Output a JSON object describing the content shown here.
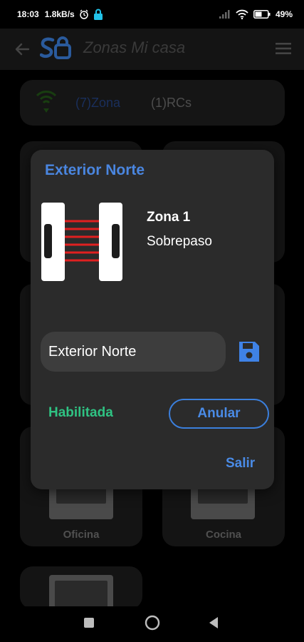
{
  "status_bar": {
    "time": "18:03",
    "speed": "1.8kB/s",
    "battery": "49%"
  },
  "app_bar": {
    "title": "Zonas Mi casa"
  },
  "tabs": {
    "zonas": "(7)Zona",
    "rcs": "(1)RCs"
  },
  "zones": [
    {
      "label": "Oficina"
    },
    {
      "label": "Cocina"
    }
  ],
  "dialog": {
    "title": "Exterior Norte",
    "zone_name": "Zona 1",
    "zone_type": "Sobrepaso",
    "name_value": "Exterior Norte",
    "status": "Habilitada",
    "cancel_label": "Anular",
    "exit_label": "Salir"
  },
  "colors": {
    "accent_blue": "#4a86e0",
    "enabled_green": "#2fc383",
    "beam_red": "#e02020"
  },
  "icons": {
    "back": "arrow-left-icon",
    "menu": "hamburger-menu-icon",
    "logo": "sa-logo",
    "wifi": "wifi-signal-icon",
    "save": "floppy-disk-icon",
    "beam": "beam-sensor-icon"
  }
}
